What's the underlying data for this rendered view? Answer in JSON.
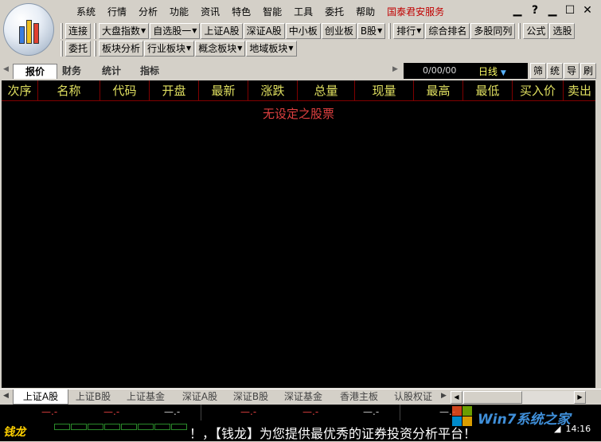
{
  "menu": [
    "系统",
    "行情",
    "分析",
    "功能",
    "资讯",
    "特色",
    "智能",
    "工具",
    "委托",
    "帮助"
  ],
  "menu_highlight": "国泰君安服务",
  "window_buttons": [
    "▁",
    "?",
    "▁",
    "☐",
    "✕"
  ],
  "toolbar1": [
    "连接",
    "大盘指数",
    "自选股一",
    "上证A股",
    "深证A股",
    "中小板",
    "创业板",
    "B股",
    "排行",
    "综合排名",
    "多股同列",
    "公式",
    "选股"
  ],
  "toolbar2": [
    "委托",
    "板块分析",
    "行业板块",
    "概念板块",
    "地域板块"
  ],
  "tabs": [
    "报价",
    "财务",
    "统计",
    "指标"
  ],
  "date": "0/00/00",
  "period": "日线",
  "side_buttons": [
    "筛",
    "统",
    "导",
    "刷"
  ],
  "columns": [
    "次序",
    "名称",
    "代码",
    "开盘",
    "最新",
    "涨跌",
    "总量",
    "现量",
    "最高",
    "最低",
    "买入价",
    "卖出"
  ],
  "empty_message": "无设定之股票",
  "sheet_tabs": [
    "上证A股",
    "上证B股",
    "上证基金",
    "深证A股",
    "深证B股",
    "深证基金",
    "香港主板",
    "认股权证"
  ],
  "index_values": [
    "—.-",
    "—.-",
    "—.-",
    "—.-",
    "—.-",
    "—.-",
    "—.-"
  ],
  "ticker_logo": "钱龙",
  "ticker_text": "！，【钱龙】为您提供最优秀的证券投资分析平台！",
  "time": "14:16",
  "watermark": "Win7系统之家",
  "colors": {
    "header_text": "#e0e060",
    "grid_line": "#800000",
    "empty_text": "#e04040",
    "background": "#000000"
  }
}
